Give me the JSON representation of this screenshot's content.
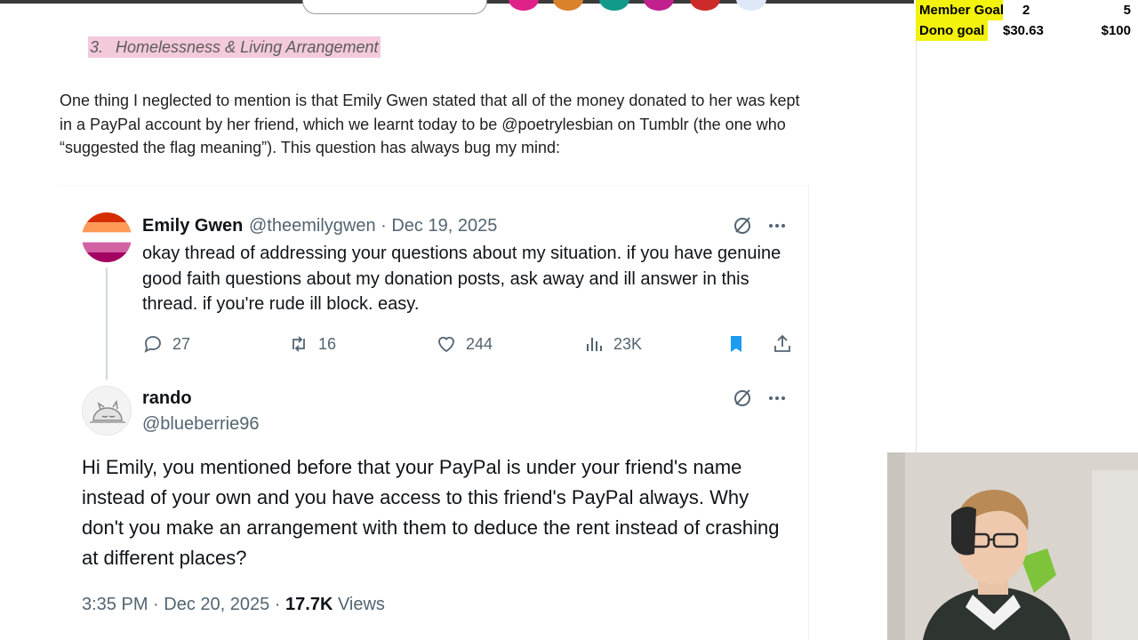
{
  "doc": {
    "heading_num": "3.",
    "heading_text": "Homelessness & Living Arrangement",
    "paragraph": "One thing I neglected to mention is that Emily Gwen stated that all of the money donated to her was kept in a PayPal account by her friend, which we learnt today to be @poetrylesbian on Tumblr (the one who “suggested the flag meaning”). This question has always bug my mind:"
  },
  "tweet1": {
    "name": "Emily Gwen",
    "handle_date": "@theemilygwen · Dec 19, 2025",
    "text": "okay thread of addressing your questions about my situation. if you have genuine good faith questions about my donation posts, ask away and ill answer in this thread. if you're rude ill block. easy.",
    "replies": "27",
    "reposts": "16",
    "likes": "244",
    "views": "23K"
  },
  "tweet2": {
    "name": "rando",
    "handle": "@blueberrie96",
    "text": "Hi Emily, you mentioned before that your PayPal is under your friend's name instead of your own and you have access to this friend's PayPal always. Why don't you make an arrangement with them to deduce the rent instead of crashing at different places?",
    "time": "3:35 PM · Dec 20, 2025 · ",
    "views_count": "17.7K",
    "views_label": " Views"
  },
  "goals": {
    "member_label": "Member Goal",
    "member_current": "2",
    "member_target": "5",
    "dono_label": "Dono goal",
    "dono_current": "$30.63",
    "dono_target": "$100"
  },
  "icons": [
    "grok-icon",
    "more-icon",
    "reply-icon",
    "repost-icon",
    "like-icon",
    "views-icon",
    "bookmark-icon",
    "share-icon"
  ],
  "colors": {
    "highlight": "#f3c9dc",
    "goal_label": "#f2f20c",
    "bookmark": "#1d9bf0",
    "muted": "#536471"
  }
}
